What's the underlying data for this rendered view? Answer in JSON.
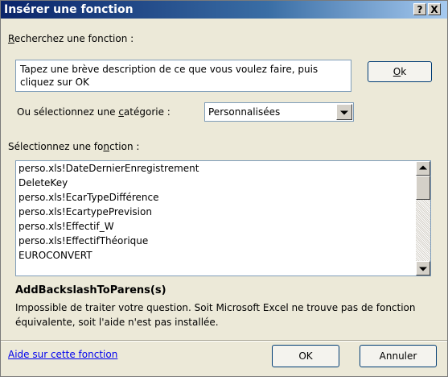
{
  "dialog": {
    "title": "Insérer une fonction",
    "help_button": "?",
    "close_button": "X"
  },
  "search": {
    "label_prefix": "",
    "label_underlined": "R",
    "label_suffix": "echerchez une fonction :",
    "value": "Tapez une brève description de ce que vous voulez faire, puis cliquez sur OK",
    "ok_underlined": "O",
    "ok_suffix": "k"
  },
  "category": {
    "label_prefix": "Ou sélectionnez une ",
    "label_underlined": "c",
    "label_suffix": "atégorie :",
    "selected": "Personnalisées"
  },
  "function_list": {
    "label_prefix": "Sélectionnez une fo",
    "label_underlined": "n",
    "label_suffix": "ction :",
    "items": [
      "perso.xls!DateDernierEnregistrement",
      "DeleteKey",
      "perso.xls!EcarTypeDifférence",
      "perso.xls!EcartypePrevision",
      "perso.xls!Effectif_W",
      "perso.xls!EffectifThéorique",
      "EUROCONVERT"
    ]
  },
  "description": {
    "function_signature": "AddBackslashToParens(s)",
    "text": "Impossible de traiter votre question. Soit Microsoft Excel ne trouve pas de fonction équivalente, soit l'aide n'est pas installée."
  },
  "footer": {
    "help_link": "Aide sur cette fonction",
    "ok_label": "OK",
    "cancel_label": "Annuler"
  }
}
